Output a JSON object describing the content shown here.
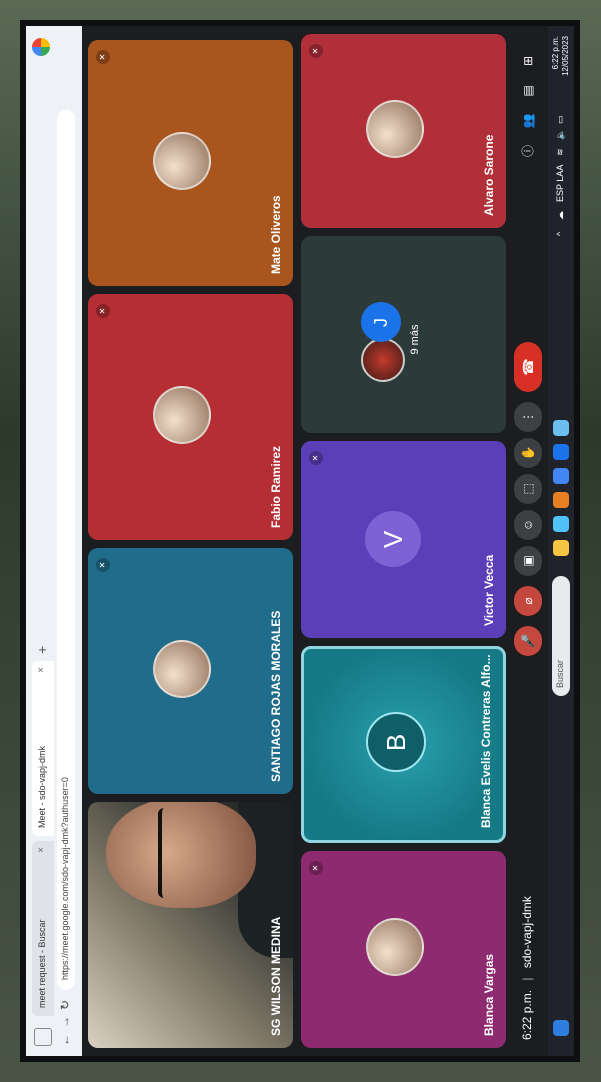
{
  "browser": {
    "tabs": [
      {
        "label": "meet request - Buscar"
      },
      {
        "label": "Meet - sdo-vapj-dmk"
      }
    ],
    "url": "https://meet.google.com/sdo-vapj-dmk?authuser=0"
  },
  "participants": [
    {
      "name": "SG WILSON MEDINA",
      "kind": "camera"
    },
    {
      "name": "SANTIAGO ROJAS MORALES",
      "kind": "avatar",
      "color": "#1f6d8a"
    },
    {
      "name": "Fabio Ramirez",
      "kind": "avatar",
      "color": "#b52e34"
    },
    {
      "name": "Mate Oliveros",
      "kind": "avatar",
      "color": "#a8551e"
    },
    {
      "name": "Blanca Vargas",
      "kind": "avatar",
      "color": "#8e2a6f"
    },
    {
      "name": "Blanca Evelis Contreras Alfo...",
      "kind": "letter",
      "letter": "B",
      "color": "#1b8a96"
    },
    {
      "name": "Victor Vecca",
      "kind": "letter",
      "letter": "V",
      "color": "#5b3fb8"
    },
    {
      "name": "",
      "kind": "more",
      "letter": "J",
      "more_text": "9 más",
      "color": "#2c3b3a"
    },
    {
      "name": "Alvaro Sarone",
      "kind": "avatar",
      "color": "#b02f38"
    }
  ],
  "toolbar": {
    "time": "6:22 p.m.",
    "separator": "|",
    "meeting_code": "sdo-vapj-dmk",
    "end_call_icon": "phone-hangup-icon"
  },
  "taskbar": {
    "search_placeholder": "Buscar",
    "lang": "ESP",
    "lang_sub": "LAA",
    "clock_time": "6:22 p.m.",
    "clock_date": "12/05/2023"
  }
}
